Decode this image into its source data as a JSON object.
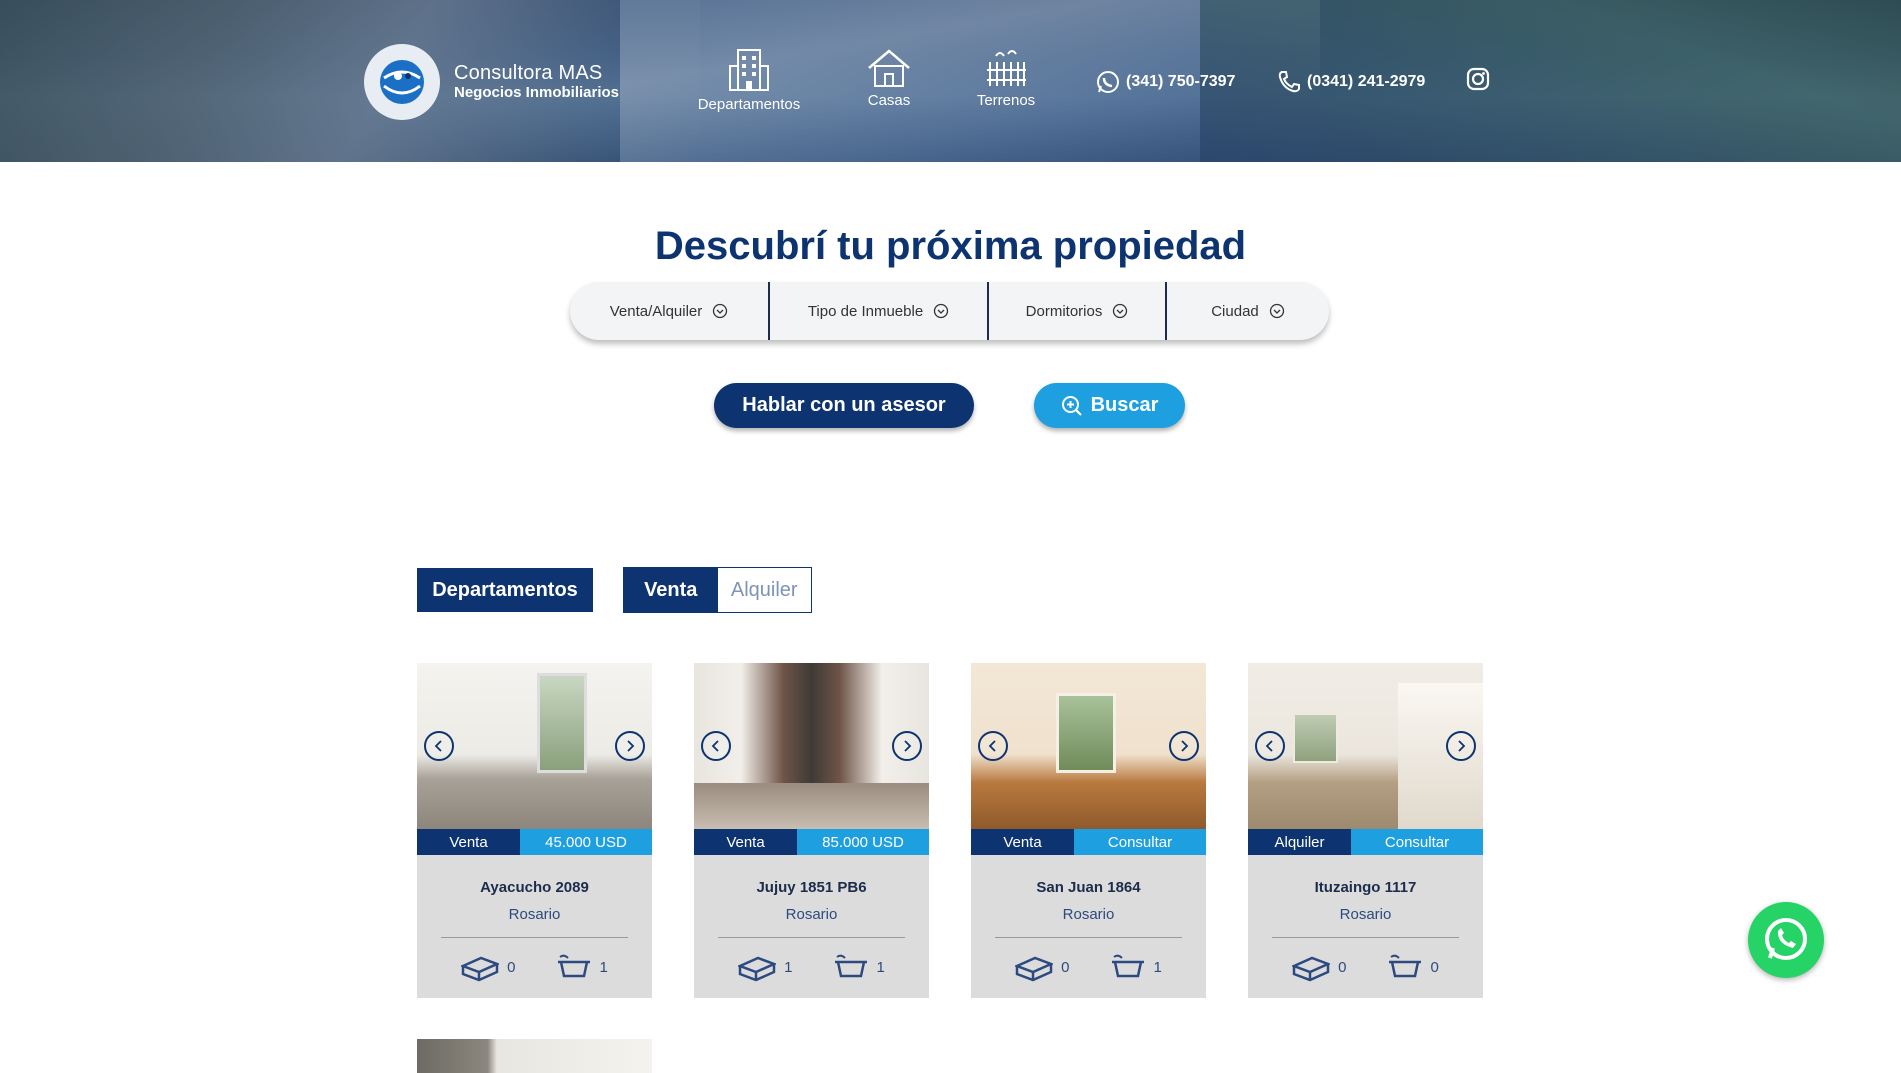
{
  "brand": {
    "name": "Consultora MAS",
    "subtitle": "Negocios Inmobiliarios"
  },
  "nav": [
    {
      "label": "Departamentos",
      "icon": "building-icon"
    },
    {
      "label": "Casas",
      "icon": "house-icon"
    },
    {
      "label": "Terrenos",
      "icon": "land-plot-icon"
    }
  ],
  "contact": {
    "whatsapp_phone": "(341) 750-7397",
    "phone": "(0341) 241-2979"
  },
  "hero": {
    "title": "Descubrí tu próxima propiedad"
  },
  "filters": [
    "Venta/Alquiler",
    "Tipo de Inmueble",
    "Dormitorios",
    "Ciudad"
  ],
  "actions": {
    "advisor_label": "Hablar con un asesor",
    "search_label": "Buscar"
  },
  "listing": {
    "category": "Departamentos",
    "toggle": {
      "active": "Venta",
      "inactive": "Alquiler"
    }
  },
  "cards": [
    {
      "operation": "Venta",
      "price": "45.000 USD",
      "address": "Ayacucho 2089",
      "city": "Rosario",
      "bedrooms": "0",
      "bathrooms": "1"
    },
    {
      "operation": "Venta",
      "price": "85.000 USD",
      "address": "Jujuy 1851 PB6",
      "city": "Rosario",
      "bedrooms": "1",
      "bathrooms": "1"
    },
    {
      "operation": "Venta",
      "price": "Consultar",
      "address": "San Juan 1864",
      "city": "Rosario",
      "bedrooms": "0",
      "bathrooms": "1"
    },
    {
      "operation": "Alquiler",
      "price": "Consultar",
      "address": "Ituzaingo 1117",
      "city": "Rosario",
      "bedrooms": "0",
      "bathrooms": "0"
    }
  ],
  "colors": {
    "navy": "#0d3470",
    "accent_blue": "#1e9fe0",
    "whatsapp_green": "#25d366",
    "card_bg": "#dcdcdc"
  }
}
